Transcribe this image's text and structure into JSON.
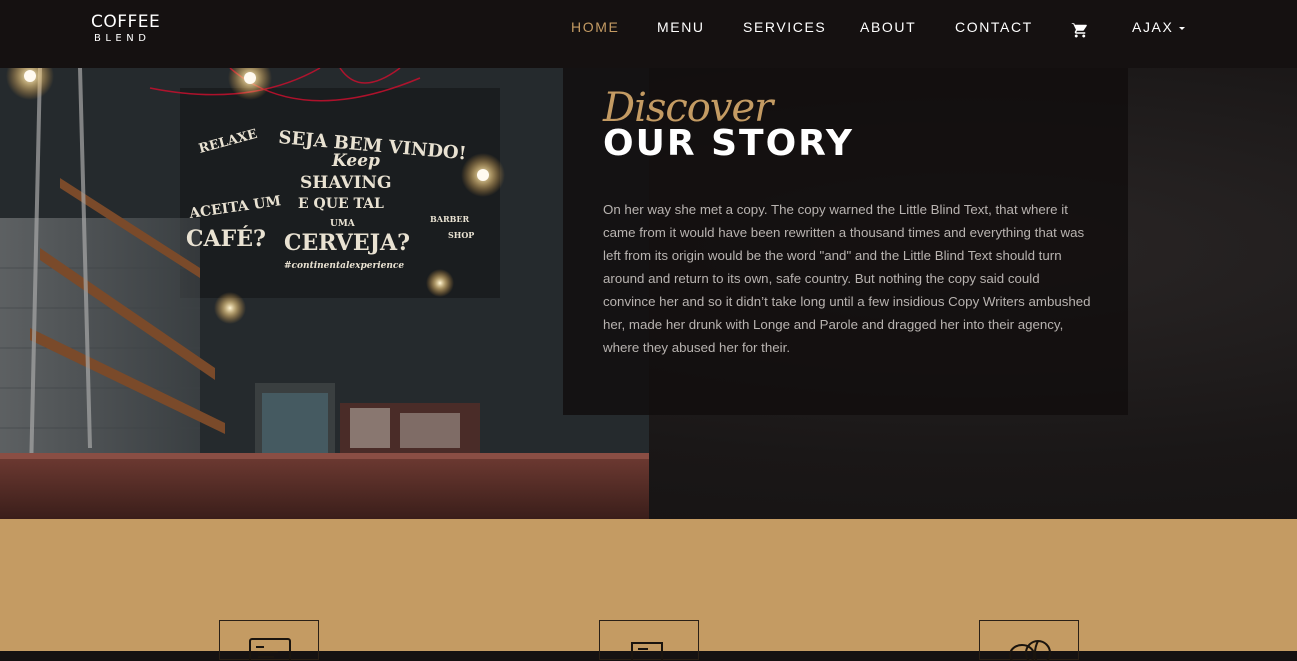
{
  "brand": {
    "line1": "COFFEE",
    "line2": "BLEND"
  },
  "nav": {
    "items": [
      {
        "label": "HOME",
        "active": true
      },
      {
        "label": "MENU",
        "active": false
      },
      {
        "label": "SERVICES",
        "active": false
      },
      {
        "label": "ABOUT",
        "active": false
      },
      {
        "label": "CONTACT",
        "active": false
      }
    ],
    "cart_icon": "cart-icon",
    "account": {
      "label": "AJAX",
      "icon": "caret-down-icon"
    }
  },
  "hero": {
    "subheading": "Discover",
    "heading": "OUR STORY",
    "body": "On her way she met a copy. The copy warned the Little Blind Text, that where it came from it would have been rewritten a thousand times and everything that was left from its origin would be the word \"and\" and the Little Blind Text should turn around and return to its own, safe country. But nothing the copy said could convince her and so it didn’t take long until a few insidious Copy Writers ambushed her, made her drunk with Longe and Parole and dragged her into their agency, where they abused her for their.",
    "image": {
      "chalkboard": [
        "RELAXE",
        "SEJA BEM VINDO!",
        "Keep",
        "SHAVING",
        "E QUE TAL",
        "UMA",
        "ACEITA UM",
        "CAFÉ?",
        "CERVEJA?",
        "#continentalexperience",
        "BARBER",
        "SHOP"
      ]
    }
  },
  "services": {
    "icons": [
      "menu-card-icon",
      "delivery-icon",
      "coffee-beans-icon"
    ]
  },
  "colors": {
    "accent": "#c49b63",
    "nav_bg": "#151111",
    "services_bg": "#c49b63"
  }
}
